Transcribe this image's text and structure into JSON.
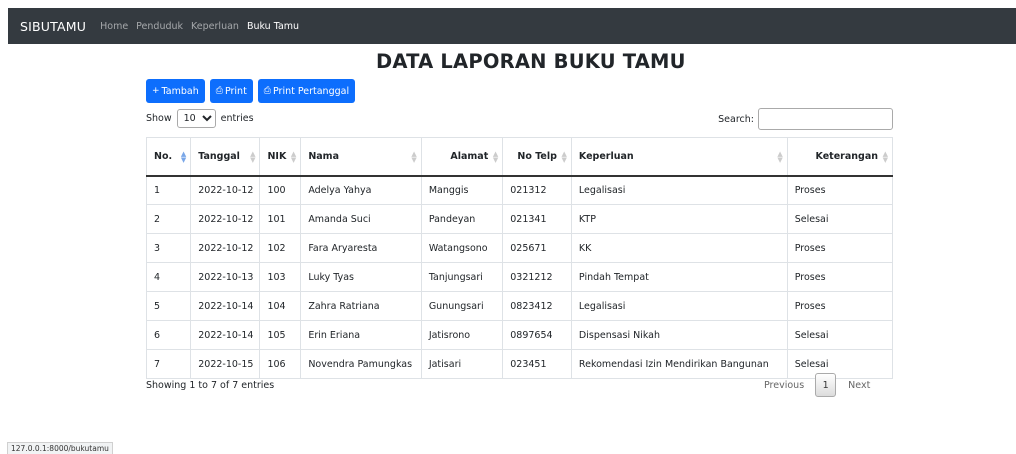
{
  "navbar": {
    "brand": "SIBUTAMU",
    "links": [
      "Home",
      "Penduduk",
      "Keperluan",
      "Buku Tamu"
    ]
  },
  "page_title": "DATA LAPORAN BUKU TAMU",
  "buttons": {
    "tambah": {
      "icon": "+",
      "label": "Tambah"
    },
    "print": {
      "icon": "⎙",
      "label": "Print"
    },
    "print_pertanggal": {
      "icon": "⎙",
      "label": "Print Pertanggal"
    }
  },
  "length_menu": {
    "prefix": "Show",
    "value": "10",
    "suffix": "entries"
  },
  "search": {
    "label": "Search:",
    "value": "",
    "placeholder": ""
  },
  "table": {
    "columns": [
      "No.",
      "Tanggal",
      "NIK",
      "Nama",
      "Alamat",
      "No Telp",
      "Keperluan",
      "Keterangan"
    ],
    "sorted_column": "No.",
    "rows": [
      [
        "1",
        "2022-10-12",
        "100",
        "Adelya Yahya",
        "Manggis",
        "021312",
        "Legalisasi",
        "Proses"
      ],
      [
        "2",
        "2022-10-12",
        "101",
        "Amanda Suci",
        "Pandeyan",
        "021341",
        "KTP",
        "Selesai"
      ],
      [
        "3",
        "2022-10-12",
        "102",
        "Fara Aryaresta",
        "Watangsono",
        "025671",
        "KK",
        "Proses"
      ],
      [
        "4",
        "2022-10-13",
        "103",
        "Luky Tyas",
        "Tanjungsari",
        "0321212",
        "Pindah Tempat",
        "Proses"
      ],
      [
        "5",
        "2022-10-14",
        "104",
        "Zahra Ratriana",
        "Gunungsari",
        "0823412",
        "Legalisasi",
        "Proses"
      ],
      [
        "6",
        "2022-10-14",
        "105",
        "Erin Eriana",
        "Jatisrono",
        "0897654",
        "Dispensasi Nikah",
        "Selesai"
      ],
      [
        "7",
        "2022-10-15",
        "106",
        "Novendra Pamungkas",
        "Jatisari",
        "023451",
        "Rekomendasi Izin Mendirikan Bangunan",
        "Selesai"
      ]
    ]
  },
  "info": "Showing 1 to 7 of 7 entries",
  "pagination": {
    "previous": "Previous",
    "current": "1",
    "next": "Next"
  },
  "status_url": "127.0.0.1:8000/bukutamu",
  "colors": {
    "navbar": "#343a40",
    "primary_button": "#0d6efd"
  }
}
